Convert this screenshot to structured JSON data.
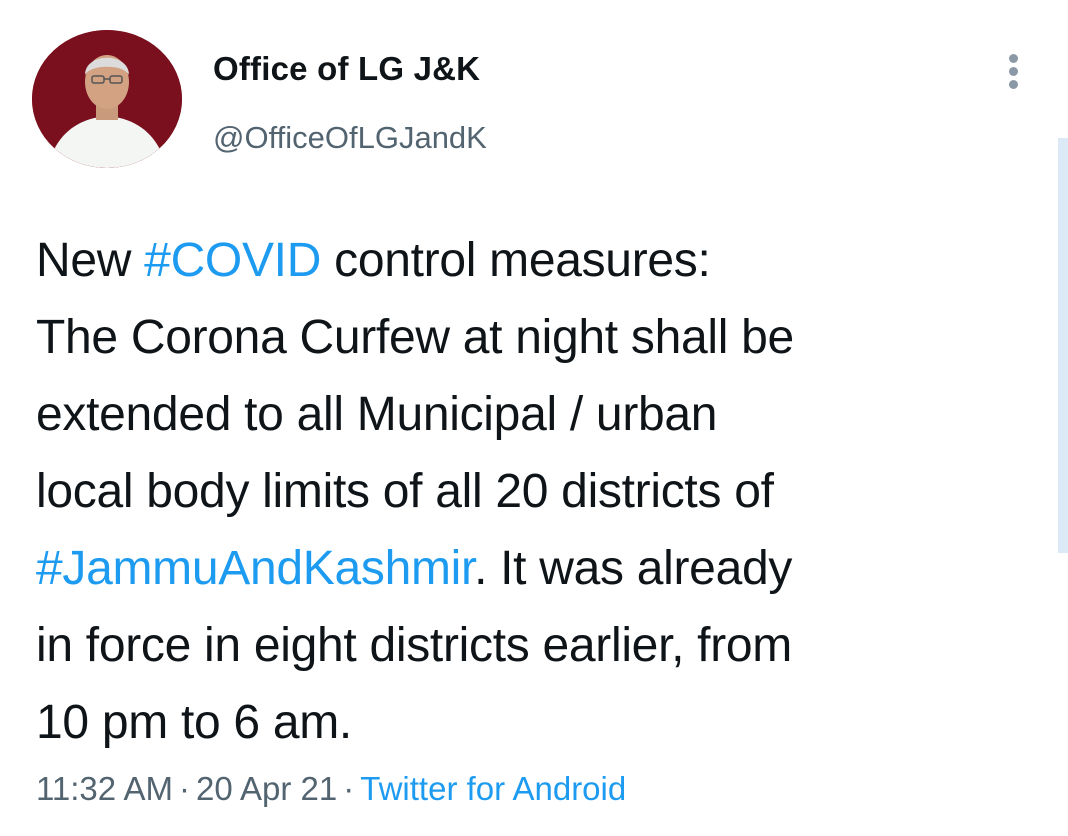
{
  "author": {
    "display_name": "Office of LG J&K",
    "handle": "@OfficeOfLGJandK",
    "avatar_icon": "profile-photo"
  },
  "menu": {
    "icon": "more-vertical-icon"
  },
  "tweet": {
    "line1_prefix": "New ",
    "hashtag_covid": "#COVID",
    "line1_suffix": " control measures:",
    "line2": "The Corona Curfew at night shall be",
    "line3": "extended to all Municipal / urban",
    "line4": "local body limits of all 20 districts of",
    "hashtag_jk": "#JammuAndKashmir",
    "line5_suffix": ". It was already",
    "line6": "in force in eight districts earlier, from",
    "line7": "10 pm to 6 am."
  },
  "meta": {
    "time": "11:32 AM",
    "separator": "·",
    "date": "20 Apr 21",
    "source": "Twitter for Android"
  },
  "colors": {
    "link": "#1d9bf0",
    "secondary_text": "#536471",
    "primary_text": "#0f1419",
    "avatar_bg": "#7a0f1e"
  }
}
